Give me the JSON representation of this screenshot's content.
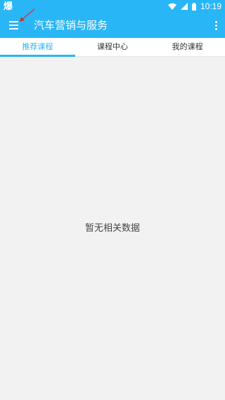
{
  "status_bar": {
    "app_glyph": "爆",
    "time": "10:19",
    "icons": [
      "wifi-icon",
      "cellular-signal-icon",
      "battery-icon"
    ]
  },
  "app_bar": {
    "title": "汽车营销与服务",
    "menu_icon": "hamburger-menu-icon",
    "more_icon": "overflow-menu-icon",
    "annotation_icon": "red-arrow-icon"
  },
  "tabs": [
    {
      "label": "推荐课程",
      "active": true
    },
    {
      "label": "课程中心",
      "active": false
    },
    {
      "label": "我的课程",
      "active": false
    }
  ],
  "empty_state": {
    "message": "暂无相关数据"
  },
  "colors": {
    "primary": "#29b6f6",
    "background": "#f2f2f2",
    "annotation": "#d32f2f"
  }
}
